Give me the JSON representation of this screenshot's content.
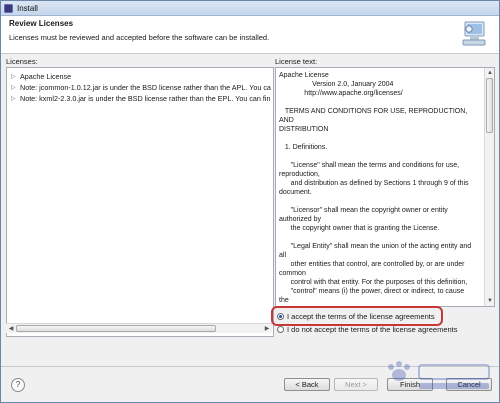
{
  "window": {
    "title": "Install"
  },
  "header": {
    "title": "Review Licenses",
    "description": "Licenses must be reviewed and accepted before the software can be installed."
  },
  "licenses_pane": {
    "label": "Licenses:",
    "items": [
      {
        "label": "Apache License"
      },
      {
        "label": "Note:  jcommon-1.0.12.jar is under the BSD license rather than the APL.  You ca"
      },
      {
        "label": "Note:  kxml2-2.3.0.jar is under the BSD license rather than the EPL.  You can fin"
      }
    ]
  },
  "license_text_pane": {
    "label": "License text:",
    "text": "Apache License\n                 Version 2.0, January 2004\n             http://www.apache.org/licenses/\n\n   TERMS AND CONDITIONS FOR USE, REPRODUCTION, AND\nDISTRIBUTION\n\n   1. Definitions.\n\n      \"License\" shall mean the terms and conditions for use,\nreproduction,\n      and distribution as defined by Sections 1 through 9 of this\ndocument.\n\n      \"Licensor\" shall mean the copyright owner or entity\nauthorized by\n      the copyright owner that is granting the License.\n\n      \"Legal Entity\" shall mean the union of the acting entity and\nall\n      other entities that control, are controlled by, or are under\ncommon\n      control with that entity. For the purposes of this definition,\n      \"control\" means (i) the power, direct or indirect, to cause\nthe"
  },
  "agreement": {
    "accept_label": "I accept the terms of the license agreements",
    "decline_label": "I do not accept the terms of the license agreements",
    "selected": "accept"
  },
  "footer": {
    "help_label": "?",
    "back_label": "< Back",
    "next_label": "Next >",
    "finish_label": "Finish",
    "cancel_label": "Cancel"
  },
  "colors": {
    "accent": "#1f4ea8",
    "highlight_border": "#c63838"
  },
  "icons": [
    "app-icon",
    "install-graphic-icon",
    "help-icon",
    "tree-expand-icon"
  ]
}
